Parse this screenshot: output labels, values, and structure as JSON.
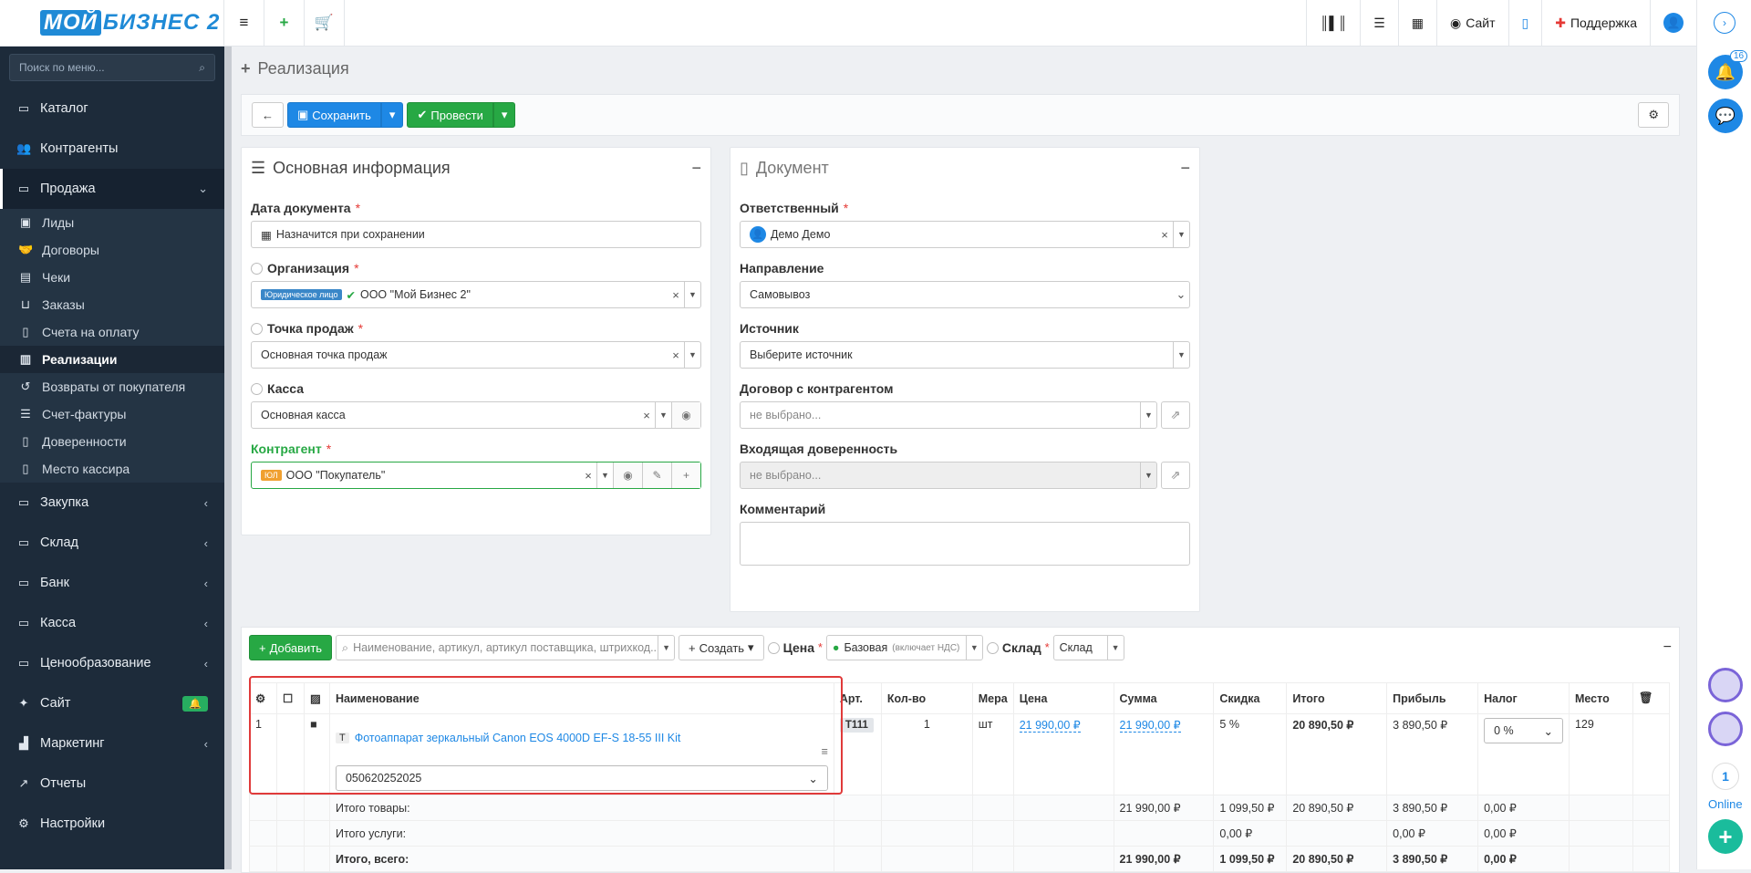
{
  "logo": {
    "line1": "МОЙ",
    "line2": "БИЗНЕС 2"
  },
  "topbar": {
    "site_label": "Сайт",
    "support_label": "Поддержка"
  },
  "sidebar": {
    "search_placeholder": "Поиск по меню...",
    "items": [
      {
        "label": "Каталог"
      },
      {
        "label": "Контрагенты"
      },
      {
        "label": "Продажа"
      }
    ],
    "sub": [
      "Лиды",
      "Договоры",
      "Чеки",
      "Заказы",
      "Счета на оплату",
      "Реализации",
      "Возвраты от покупателя",
      "Счет-фактуры",
      "Доверенности",
      "Место кассира"
    ],
    "items2": [
      "Закупка",
      "Склад",
      "Банк",
      "Касса",
      "Ценообразование",
      "Сайт",
      "Маркетинг",
      "Отчеты",
      "Настройки"
    ]
  },
  "page": {
    "title": "Реализация"
  },
  "toolbar": {
    "save": "Сохранить",
    "post": "Провести"
  },
  "main_info": {
    "title": "Основная информация",
    "date_label": "Дата документа",
    "date_value": "Назначится при сохранении",
    "org_label": "Организация",
    "org_tag": "Юридическое лицо",
    "org_value": "ООО \"Мой Бизнес 2\"",
    "pos_label": "Точка продаж",
    "pos_value": "Основная точка продаж",
    "cash_label": "Касса",
    "cash_value": "Основная касса",
    "contr_label": "Контрагент",
    "contr_tag": "ЮЛ",
    "contr_value": "ООО \"Покупатель\""
  },
  "document": {
    "title": "Документ",
    "resp_label": "Ответственный",
    "resp_value": "Демо Демо",
    "dir_label": "Направление",
    "dir_value": "Самовывоз",
    "src_label": "Источник",
    "src_value": "Выберите источник",
    "contract_label": "Договор с контрагентом",
    "contract_value": "не выбрано...",
    "proxy_label": "Входящая доверенность",
    "proxy_value": "не выбрано...",
    "comment_label": "Комментарий"
  },
  "items": {
    "add": "Добавить",
    "search_placeholder": "Наименование, артикул, артикул поставщика, штрихкод...",
    "create": "Создать",
    "price_label": "Цена",
    "price_value": "Базовая",
    "price_note": "(включает НДС)",
    "stock_label": "Склад",
    "stock_value": "Склад",
    "headers": [
      "Наименование",
      "Арт.",
      "Кол-во",
      "Мера",
      "Цена",
      "Сумма",
      "Скидка",
      "Итого",
      "Прибыль",
      "Налог",
      "Место"
    ],
    "row": {
      "num": "1",
      "type": "Т",
      "name": "Фотоаппарат зеркальный Canon EOS 4000D EF-S 18-55 III Kit",
      "serial": "050620252025",
      "art": "T111",
      "qty": "1",
      "unit": "шт",
      "price": "21 990,00 ₽",
      "sum": "21 990,00 ₽",
      "discount": "5 %",
      "total": "20 890,50 ₽",
      "profit": "3 890,50 ₽",
      "tax": "0 %",
      "place": "129"
    },
    "sum_goods": {
      "label": "Итого товары:",
      "sum": "21 990,00 ₽",
      "discount": "1 099,50 ₽",
      "total": "20 890,50 ₽",
      "profit": "3 890,50 ₽",
      "tax": "0,00 ₽"
    },
    "sum_services": {
      "label": "Итого услуги:",
      "discount": "0,00 ₽",
      "profit": "0,00 ₽",
      "tax": "0,00 ₽"
    },
    "sum_all": {
      "label": "Итого, всего:",
      "sum": "21 990,00 ₽",
      "discount": "1 099,50 ₽",
      "total": "20 890,50 ₽",
      "profit": "3 890,50 ₽",
      "tax": "0,00 ₽"
    }
  },
  "rightbar": {
    "notif_count": "16",
    "online_count": "1",
    "online_label": "Online"
  }
}
